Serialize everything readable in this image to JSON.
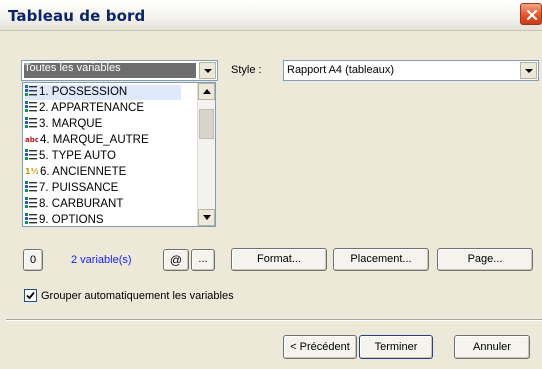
{
  "window": {
    "title": "Tableau de bord"
  },
  "variables_filter": {
    "value": "Toutes les variables"
  },
  "style": {
    "label": "Style :",
    "value": "Rapport A4 (tableaux)"
  },
  "variables_list": [
    {
      "label": "1. POSSESSION",
      "icon": "categorical-icon",
      "selected": true
    },
    {
      "label": "2. APPARTENANCE",
      "icon": "categorical-icon",
      "selected": false
    },
    {
      "label": "3. MARQUE",
      "icon": "categorical-icon",
      "selected": false
    },
    {
      "label": "4. MARQUE_AUTRE",
      "icon": "text-icon",
      "icon_text": "abc",
      "selected": false
    },
    {
      "label": "5. TYPE AUTO",
      "icon": "categorical-icon",
      "selected": false
    },
    {
      "label": "6. ANCIENNETE",
      "icon": "numeric-icon",
      "icon_text": "1½",
      "selected": false
    },
    {
      "label": "7. PUISSANCE",
      "icon": "categorical-icon",
      "selected": false
    },
    {
      "label": "8. CARBURANT",
      "icon": "categorical-icon",
      "selected": false
    },
    {
      "label": "9. OPTIONS",
      "icon": "categorical-icon",
      "selected": false
    }
  ],
  "counter": {
    "zero_label": "0",
    "count_text": "2 variable(s)",
    "at_label": "@",
    "ellipsis_label": "..."
  },
  "buttons": {
    "format": "Format...",
    "placement": "Placement...",
    "page": "Page...",
    "back": "< Précédent",
    "finish": "Terminer",
    "cancel": "Annuler"
  },
  "options": {
    "auto_group_label": "Grouper automatiquement les variables",
    "auto_group_checked": true
  },
  "colors": {
    "title": "#0a246a",
    "count": "#1a1aff",
    "selection": "#6e6e6e",
    "close": "#e4572f"
  }
}
